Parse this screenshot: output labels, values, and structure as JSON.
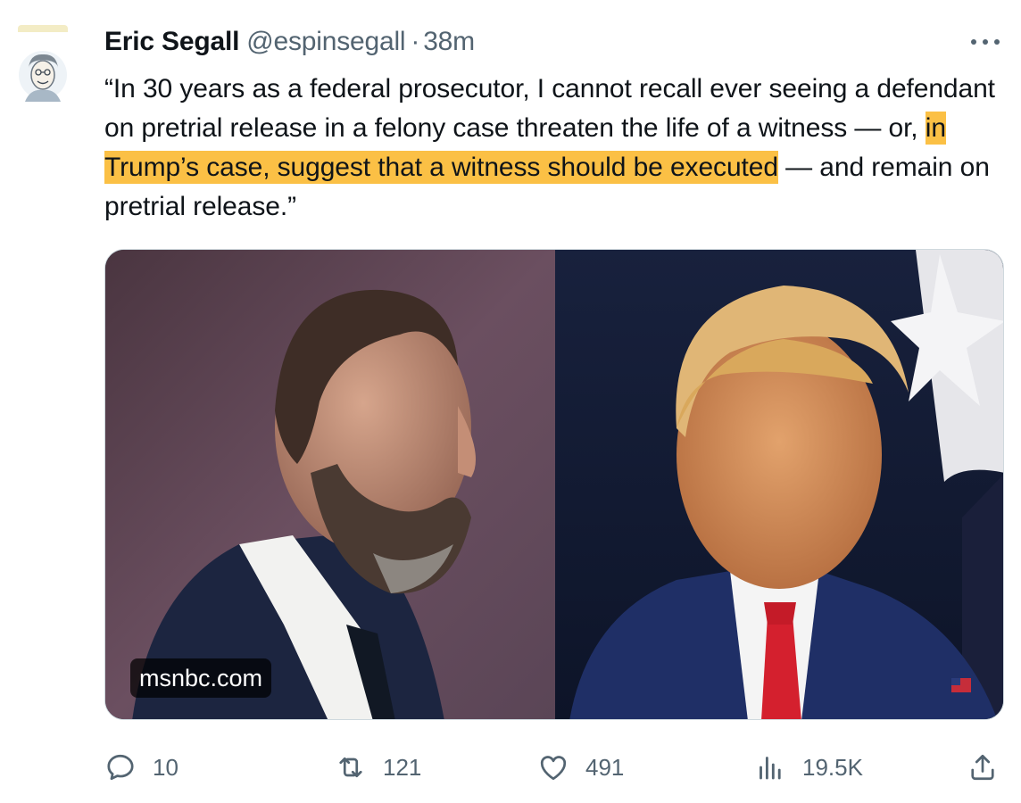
{
  "tweet": {
    "author_name": "Eric Segall",
    "handle": "@espinsegall",
    "separator": "·",
    "time": "38m",
    "text_part1": "“In 30 years as a federal prosecutor, I cannot recall ever seeing a defendant on pretrial release in a felony case threaten the life of a witness — or, ",
    "text_highlight": "in Trump’s case, suggest that a witness should be executed",
    "text_part2": " — and remain on pretrial release.”",
    "highlight_color": "#fbc045"
  },
  "media": {
    "source_label": "msnbc.com",
    "left_photo": "man-with-beard-in-suit",
    "right_photo": "trump-with-red-tie"
  },
  "actions": {
    "replies": "10",
    "retweets": "121",
    "likes": "491",
    "views": "19.5K"
  },
  "icons": {
    "reply": "reply-icon",
    "retweet": "retweet-icon",
    "like": "heart-icon",
    "views": "views-chart-icon",
    "share": "share-icon",
    "more": "more-dots-icon"
  },
  "colors": {
    "text": "#0f1419",
    "secondary": "#536471",
    "border": "#cfd9de"
  }
}
